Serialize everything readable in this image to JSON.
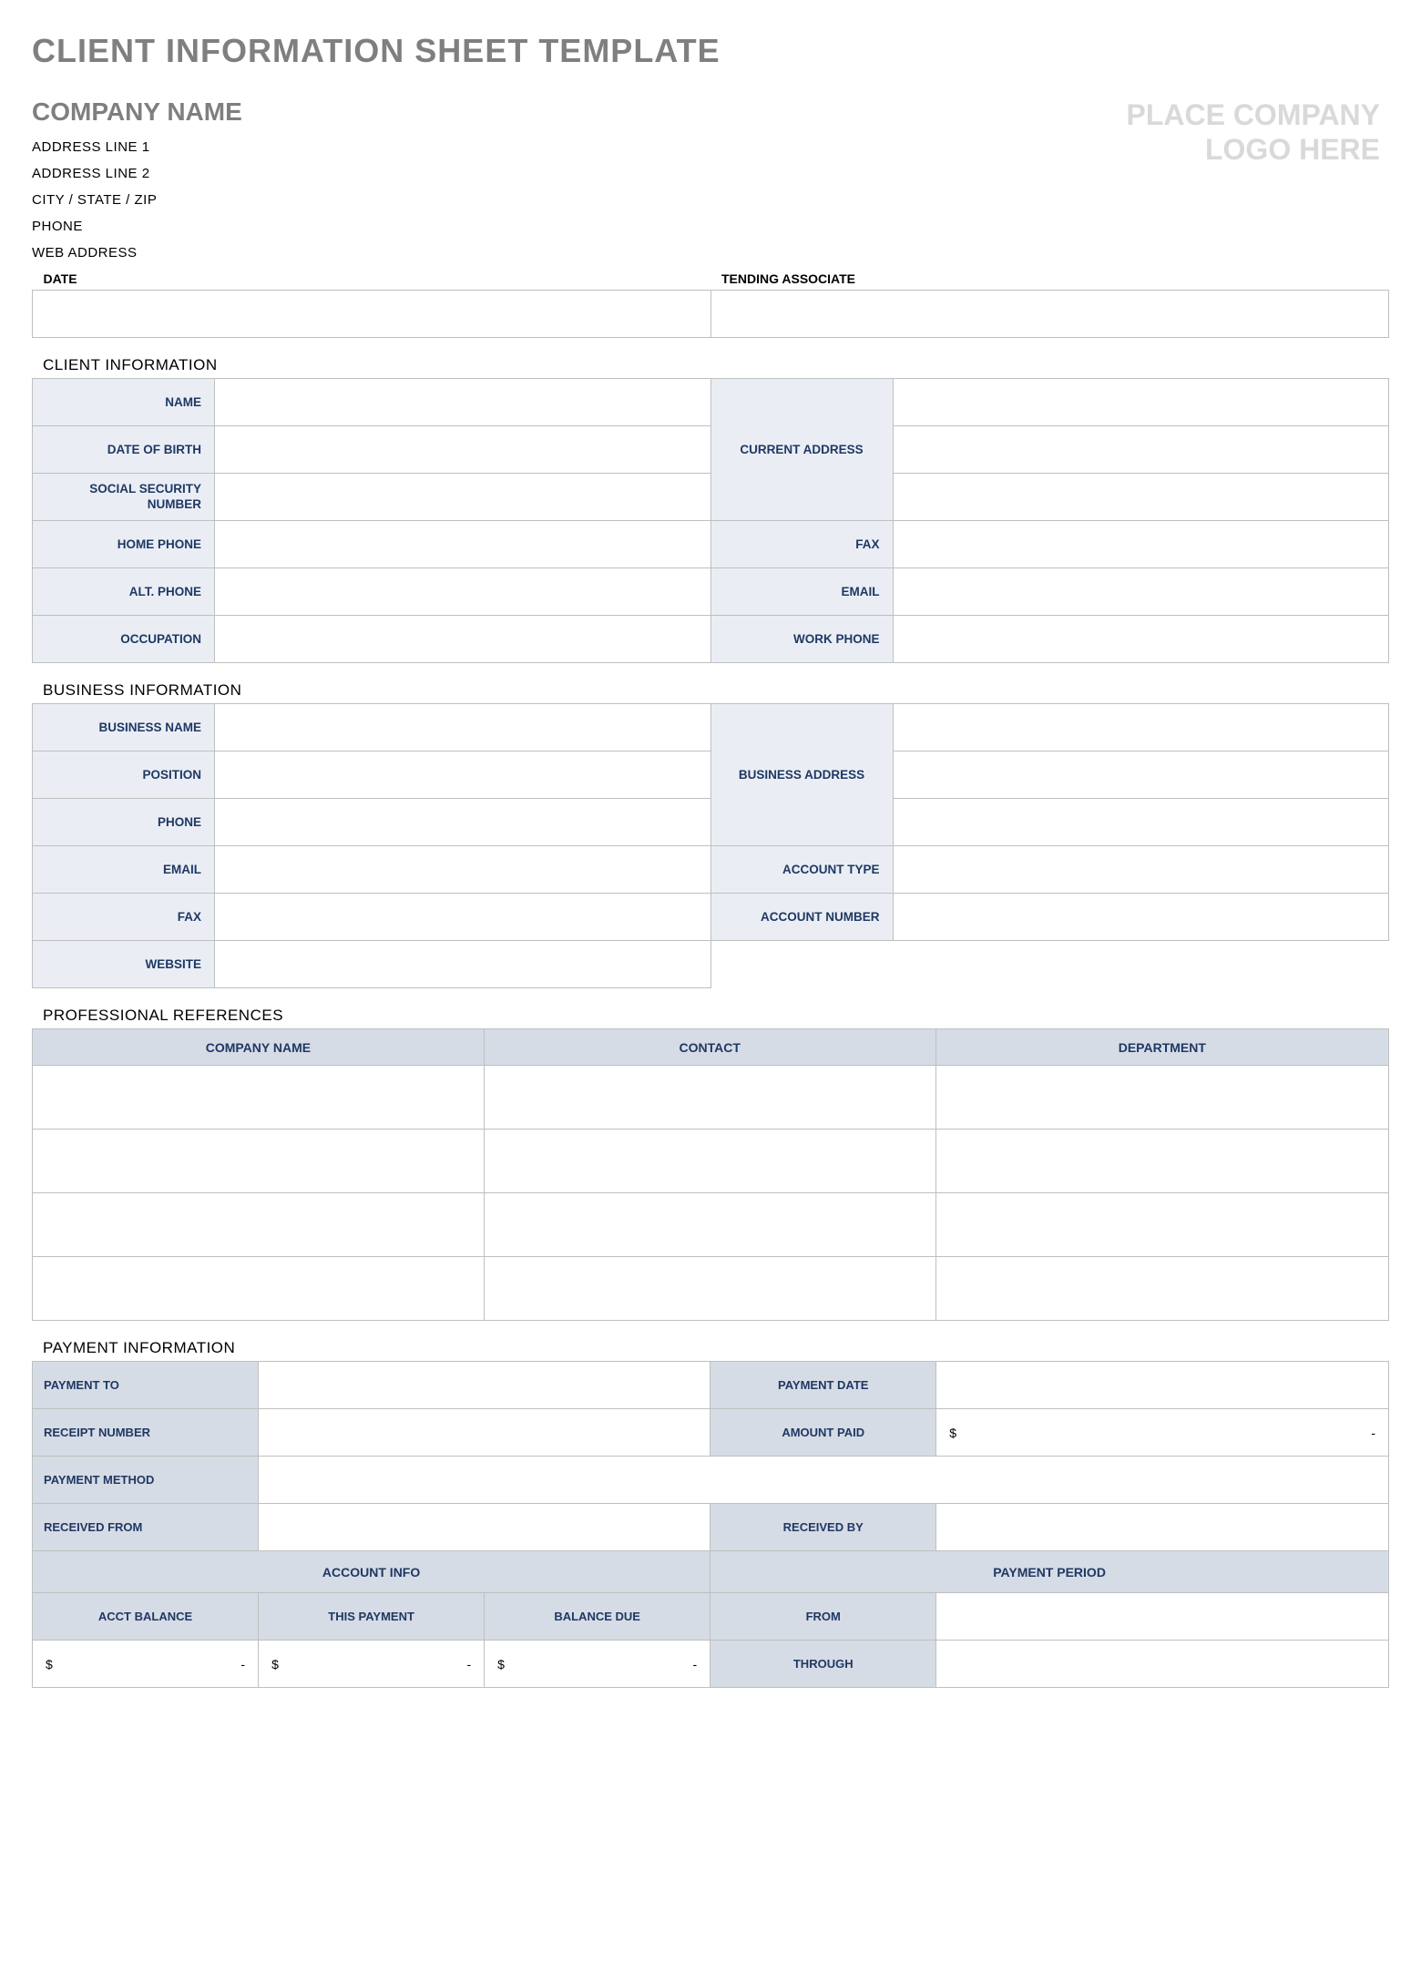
{
  "title": "CLIENT INFORMATION SHEET TEMPLATE",
  "company": {
    "name": "COMPANY NAME",
    "address1": "ADDRESS LINE 1",
    "address2": "ADDRESS LINE 2",
    "csz": "CITY / STATE / ZIP",
    "phone": "PHONE",
    "web": "WEB ADDRESS"
  },
  "logo_line1": "PLACE COMPANY",
  "logo_line2": "LOGO HERE",
  "top": {
    "date_label": "DATE",
    "associate_label": "TENDING ASSOCIATE"
  },
  "client": {
    "section": "CLIENT INFORMATION",
    "name": "NAME",
    "dob": "DATE OF BIRTH",
    "ssn1": "SOCIAL SECURITY",
    "ssn2": "NUMBER",
    "home_phone": "HOME PHONE",
    "alt_phone": "ALT. PHONE",
    "occupation": "OCCUPATION",
    "current_address": "CURRENT ADDRESS",
    "fax": "FAX",
    "email": "EMAIL",
    "work_phone": "WORK PHONE"
  },
  "business": {
    "section": "BUSINESS INFORMATION",
    "name": "BUSINESS NAME",
    "position": "POSITION",
    "phone": "PHONE",
    "email": "EMAIL",
    "fax": "FAX",
    "website": "WEBSITE",
    "address": "BUSINESS ADDRESS",
    "acct_type": "ACCOUNT TYPE",
    "acct_number": "ACCOUNT NUMBER"
  },
  "refs": {
    "section": "PROFESSIONAL REFERENCES",
    "col_company": "COMPANY NAME",
    "col_contact": "CONTACT",
    "col_dept": "DEPARTMENT"
  },
  "pay": {
    "section": "PAYMENT INFORMATION",
    "payment_to": "PAYMENT TO",
    "payment_date": "PAYMENT DATE",
    "receipt_number": "RECEIPT NUMBER",
    "amount_paid": "AMOUNT PAID",
    "payment_method": "PAYMENT METHOD",
    "received_from": "RECEIVED FROM",
    "received_by": "RECEIVED BY",
    "account_info": "ACCOUNT INFO",
    "payment_period": "PAYMENT PERIOD",
    "acct_balance": "ACCT BALANCE",
    "this_payment": "THIS PAYMENT",
    "balance_due": "BALANCE DUE",
    "from": "FROM",
    "through": "THROUGH",
    "currency": "$",
    "dash": "-"
  }
}
